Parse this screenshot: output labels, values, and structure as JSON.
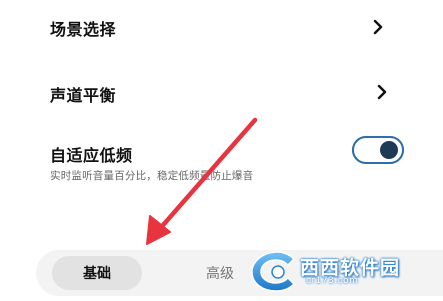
{
  "settings": {
    "scene_select": {
      "label": "场景选择",
      "icon": "chevron-right-icon"
    },
    "channel_balance": {
      "label": "声道平衡",
      "icon": "chevron-right-icon"
    },
    "adaptive_bass": {
      "label": "自适应低频",
      "description": "实时监听音量百分比，稳定低频量防止爆音",
      "enabled": true
    }
  },
  "tabs": [
    {
      "label": "基础",
      "selected": true
    },
    {
      "label": "高级",
      "selected": false
    }
  ],
  "watermark": {
    "text": "西西软件园",
    "url": "cr173.com"
  },
  "annotation": {
    "icon": "red-arrow-icon",
    "color": "#e8343f"
  },
  "colors": {
    "toggle_accent": "#2f6fa8",
    "toggle_knob": "#1f3a56",
    "tab_selected_bg": "#e2e2e2",
    "tabbar_bg": "#f3f3f3"
  }
}
